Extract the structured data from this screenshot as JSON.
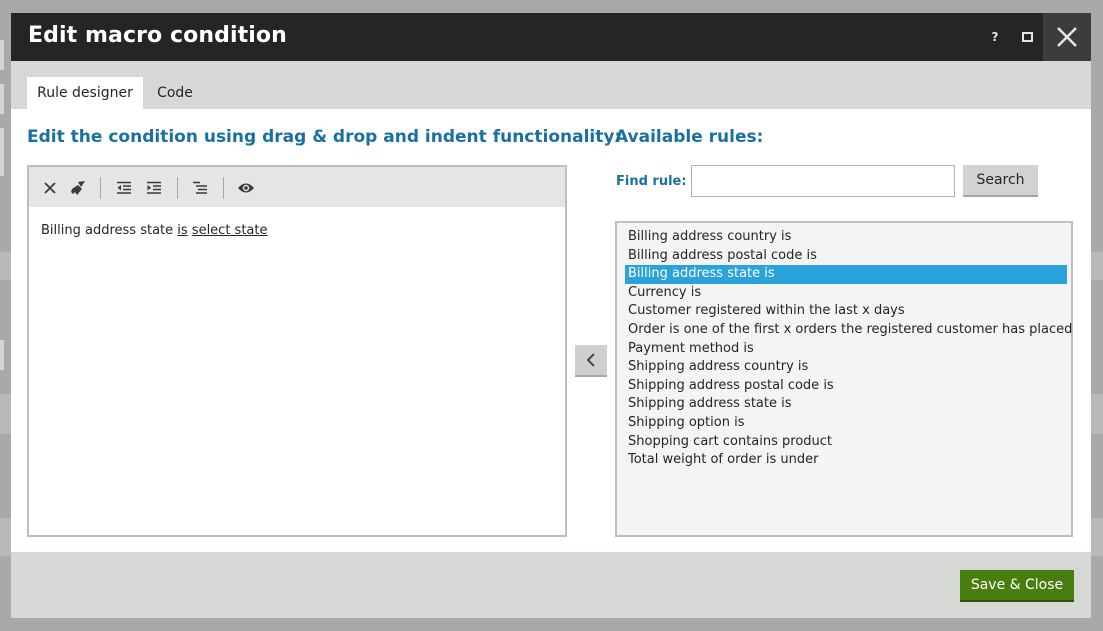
{
  "dialog": {
    "title": "Edit macro condition",
    "help_label": "?"
  },
  "tabs": [
    {
      "label": "Rule designer",
      "active": true
    },
    {
      "label": "Code",
      "active": false
    }
  ],
  "editor": {
    "heading": "Edit the condition using drag & drop and indent functionality:",
    "toolbar_icons": [
      "delete-icon",
      "clear-icon",
      "outdent-icon",
      "indent-icon",
      "align-icon",
      "preview-icon"
    ],
    "condition": {
      "prefix": "Billing address state ",
      "operator": "is",
      "value": "select state"
    }
  },
  "rules": {
    "heading": "Available rules:",
    "find_label": "Find rule:",
    "search_value": "",
    "search_button": "Search",
    "selected_index": 2,
    "items": [
      "Billing address country is",
      "Billing address postal code is",
      "Billing address state is",
      "Currency is",
      "Customer registered within the last x days",
      "Order is one of the first x orders the registered customer has placed",
      "Payment method is",
      "Shipping address country is",
      "Shipping address postal code is",
      "Shipping address state is",
      "Shipping option is",
      "Shopping cart contains product",
      "Total weight of order is under"
    ]
  },
  "footer": {
    "save_label": "Save & Close"
  },
  "colors": {
    "title_bg": "#262524",
    "heading": "#1a6fa3",
    "selection": "#2aa2db",
    "save_button": "#497d10"
  }
}
